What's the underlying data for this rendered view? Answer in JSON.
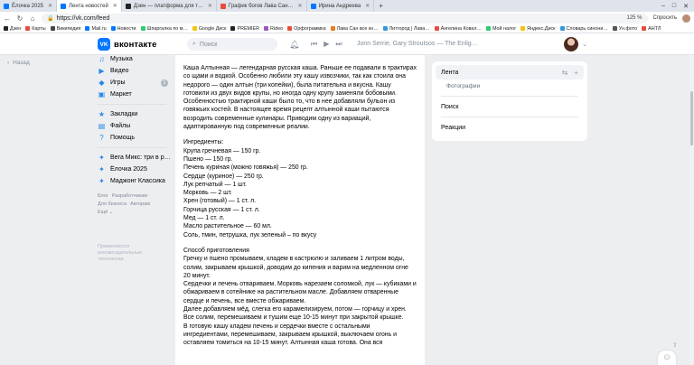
{
  "browser": {
    "tabs": [
      {
        "title": "Ёлочка 2025",
        "color": "#0077ff",
        "active": false
      },
      {
        "title": "Лента новостей",
        "color": "#0077ff",
        "active": true
      },
      {
        "title": "Дзен — платформа для т…",
        "color": "#222222",
        "active": false
      },
      {
        "title": "График богов Лава Сан…",
        "color": "#e74c3c",
        "active": false
      },
      {
        "title": "Ирина Андреева",
        "color": "#0077ff",
        "active": false
      }
    ],
    "window_controls": [
      "–",
      "□",
      "✕"
    ],
    "url": "https://vk.com/feed",
    "zoom": "125 %",
    "toolbar_right": [
      "Спросить"
    ],
    "bookmarks": [
      {
        "label": "Дзен",
        "color": "#222222"
      },
      {
        "label": "Карты",
        "color": "#e74c3c"
      },
      {
        "label": "Википедия",
        "color": "#444444"
      },
      {
        "label": "Mail.ru",
        "color": "#0077ff"
      },
      {
        "label": "Новости",
        "color": "#0077ff"
      },
      {
        "label": "Шпаргалка по м…",
        "color": "#2ecc71"
      },
      {
        "label": "Google Диск",
        "color": "#f1c40f"
      },
      {
        "label": "PREMIER",
        "color": "#222222"
      },
      {
        "label": "Rideo",
        "color": "#9b59b6"
      },
      {
        "label": "Орфограммка",
        "color": "#e74c3c"
      },
      {
        "label": "Лава Сан все кн…",
        "color": "#e67e22"
      },
      {
        "label": "Литгород | Лава…",
        "color": "#3498db"
      },
      {
        "label": "Ангелина Ковал…",
        "color": "#e74c3c"
      },
      {
        "label": "Мой налог",
        "color": "#2ecc71"
      },
      {
        "label": "Яндекс.Диск",
        "color": "#f1c40f"
      },
      {
        "label": "Словарь синони…",
        "color": "#3498db"
      },
      {
        "label": "Ун.фото",
        "color": "#555555"
      },
      {
        "label": "АНТЛ",
        "color": "#e74c3c"
      }
    ]
  },
  "header": {
    "logo_mark": "VK",
    "logo_text": "вконтакте",
    "search_placeholder": "Поиск",
    "player_track": "Jonn Serrie, Gary Stroutsos — The Enlig…"
  },
  "rail": {
    "back_label": "Назад"
  },
  "leftnav": {
    "items": [
      {
        "label": "Музыка",
        "icon": "♫"
      },
      {
        "label": "Видео",
        "icon": "▶"
      },
      {
        "label": "Игры",
        "icon": "◆",
        "badge": "1"
      },
      {
        "label": "Маркет",
        "icon": "▣"
      }
    ],
    "items2": [
      {
        "label": "Закладки",
        "icon": "★"
      },
      {
        "label": "Файлы",
        "icon": "▤"
      },
      {
        "label": "Помощь",
        "icon": "?"
      }
    ],
    "items3": [
      {
        "label": "Вега Микс: три в р…",
        "icon": "✦"
      },
      {
        "label": "Ёлочка 2025",
        "icon": "✦"
      },
      {
        "label": "Маджонг Классика",
        "icon": "✦"
      }
    ],
    "footer_links": [
      "Блог",
      "Разработчикам",
      "Для бизнеса",
      "Авторам",
      "Ещё ⌄"
    ],
    "footer_note": "Применяются рекомендательные технологии"
  },
  "post": {
    "intro": "Каша Алтынная — легендарная русская каша. Раньше ее подавали в трактирах со щами и водкой. Особенно любили эту кашу извозчики, так как стоила она недорого — один алтын (три копейки), была питательна и вкусна. Кашу готовили из двух видов крупы, но иногда одну крупу заменяли бобовыми. Особенностью трактирной каши было то, что в нее добавляли бульон из говяжьих костей. В настоящее время рецепт алтынной каши пытаются возродить современные кулинары. Приводим одну из вариаций, адаптированную под современные реалии.",
    "ingredients_title": "Ингредиенты:",
    "ingredients": [
      "Крупа гречневая — 150 гр.",
      "Пшено — 150 гр.",
      "Печень куриная (можно говяжья) — 250 гр.",
      "Сердце (куриное) — 250 гр.",
      "Лук репчатый — 1 шт.",
      "Морковь — 2 шт.",
      "Хрен (готовый) — 1 ст. л.",
      "Горчица русская — 1 ст. л.",
      "Мед — 1 ст. л.",
      "Масло растительное — 60 мл.",
      "Соль, тмин, петрушка, лук зеленый – по вкусу"
    ],
    "method_title": "Способ приготовления",
    "method": [
      "Гречку и пшено промываем, кладем в кастрюлю и заливаем 1 литром воды, солим, закрываем крышкой, доводим до кипения и варим на медленном огне 20 минут.",
      "Сердечки и печень отвариваем. Морковь нарезаем соломкой, лук — кубиками и обжариваем в сотейнике на растительном масле. Добавляем отваренные сердце и печень, все вместе обжариваем.",
      "Далее добавляем мёд, слегка его карамелизируем, потом — горчицу и хрен. Все солим, перемешиваем и тушим еще 10-15 минут при закрытой крышке.",
      "В готовую кашу кладем печень и сердечки вместе с остальными ингредиентами, перемешиваем, закрываем крышкой, выключаем огонь и оставляем томиться на 10-15 минут. Алтынная каша готова. Она вся"
    ]
  },
  "rightmenu": {
    "feed": "Лента",
    "photos": "Фотографии",
    "search": "Поиск",
    "reactions": "Реакции"
  }
}
